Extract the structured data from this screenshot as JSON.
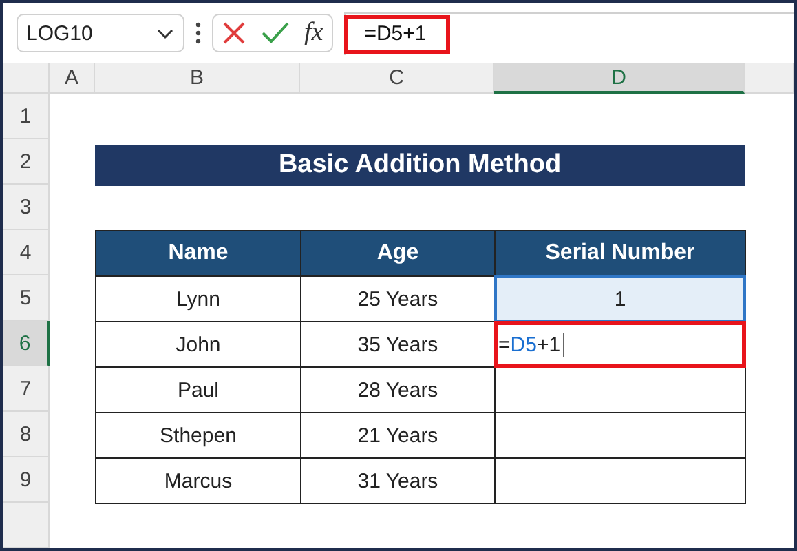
{
  "name_box": {
    "value": "LOG10"
  },
  "formula_bar": {
    "function_label": "fx",
    "value": "=D5+1"
  },
  "columns": [
    {
      "label": "A",
      "selected": false
    },
    {
      "label": "B",
      "selected": false
    },
    {
      "label": "C",
      "selected": false
    },
    {
      "label": "D",
      "selected": true
    }
  ],
  "rows": [
    {
      "label": "1",
      "selected": false
    },
    {
      "label": "2",
      "selected": false
    },
    {
      "label": "3",
      "selected": false
    },
    {
      "label": "4",
      "selected": false
    },
    {
      "label": "5",
      "selected": false
    },
    {
      "label": "6",
      "selected": true
    },
    {
      "label": "7",
      "selected": false
    },
    {
      "label": "8",
      "selected": false
    },
    {
      "label": "9",
      "selected": false
    }
  ],
  "title": "Basic Addition Method",
  "table": {
    "columns": [
      "Name",
      "Age",
      "Serial Number"
    ],
    "rows": [
      {
        "name": "Lynn",
        "age": "25 Years",
        "serial": "1",
        "referenced": true
      },
      {
        "name": "John",
        "age": "35 Years",
        "editing": {
          "prefix": "=",
          "reference": "D5",
          "suffix": "+1"
        }
      },
      {
        "name": "Paul",
        "age": "28 Years"
      },
      {
        "name": "Sthepen",
        "age": "21 Years"
      },
      {
        "name": "Marcus",
        "age": "31 Years"
      }
    ]
  }
}
